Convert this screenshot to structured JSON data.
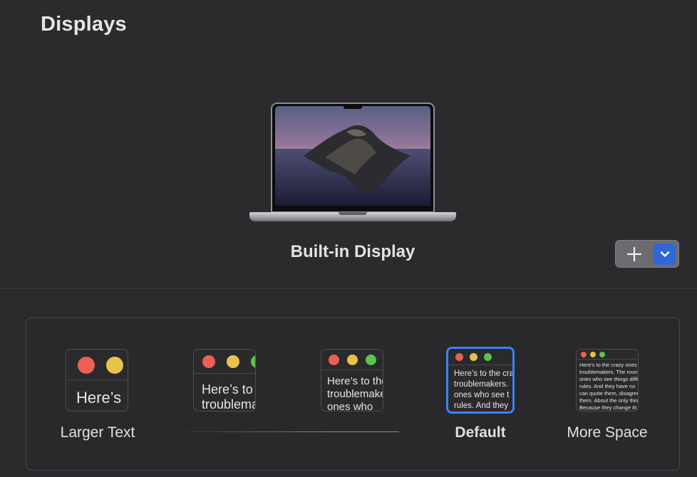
{
  "header": {
    "title": "Displays"
  },
  "display": {
    "name": "Built-in Display"
  },
  "buttons": {
    "add_label": "+"
  },
  "icons": {
    "add": "plus-icon",
    "dropdown": "chevron-down-icon"
  },
  "colors": {
    "accent": "#2f67d8",
    "selected_border": "#3b82f6",
    "red": "#ec5f55",
    "yellow": "#e5c34a",
    "green": "#5dc24c"
  },
  "resolution_options": [
    {
      "label": "Larger Text",
      "preview_lines": [
        "Here’s"
      ],
      "selected": false
    },
    {
      "label": "",
      "preview_lines": [
        "Here’s to the",
        "troublemakers"
      ],
      "selected": false
    },
    {
      "label": "",
      "preview_lines": [
        "Here’s to the",
        "troublemakers.",
        "ones who"
      ],
      "selected": false
    },
    {
      "label": "Default",
      "preview_lines": [
        "Here’s to the crazy",
        "troublemakers.",
        "ones who see t",
        "rules. And they"
      ],
      "selected": true
    },
    {
      "label": "More Space",
      "preview_lines": [
        "Here's to the crazy ones",
        "troublemakers. The round",
        "ones who see things differ",
        "rules. And they have no",
        "can quote them, disagree",
        "them. About the only thing",
        "Because they change th"
      ],
      "selected": false
    }
  ]
}
